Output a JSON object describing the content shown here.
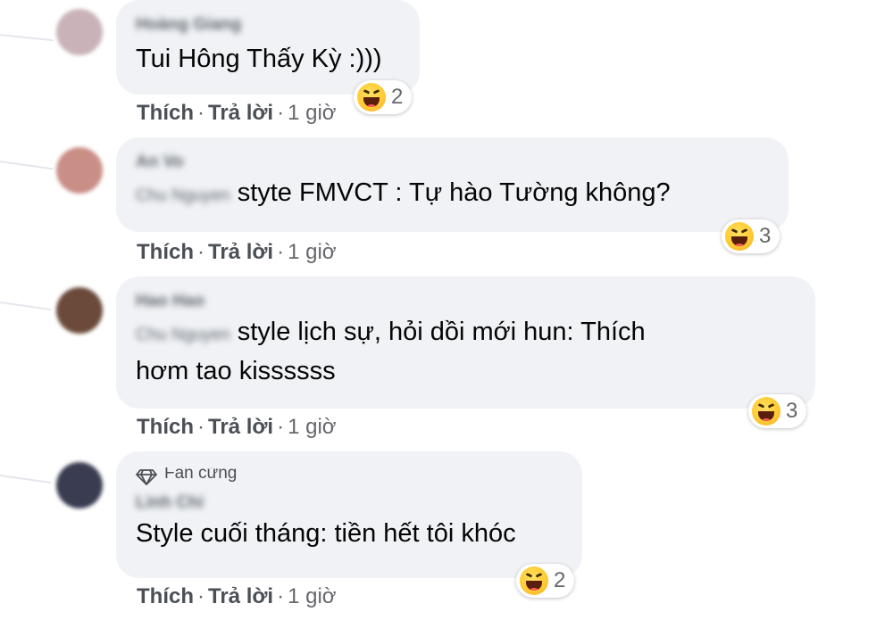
{
  "comments": [
    {
      "author_blurred": "Hoàng Giang",
      "tag_blurred": "",
      "text_line1": "Tui Hông Thấy Kỳ :)))",
      "text_line2": "",
      "reaction_count": "2",
      "actions": {
        "like": "Thích",
        "reply": "Trả lời",
        "sep": "·",
        "time": "1 giờ"
      },
      "avatar_color": "#c9b3b8"
    },
    {
      "author_blurred": "An Vo",
      "tag_blurred": "Chu Nguyen",
      "text_line1": "styte FMVCT : Tự hào Tường không?",
      "text_line2": "",
      "reaction_count": "3",
      "actions": {
        "like": "Thích",
        "reply": "Trả lời",
        "sep": "·",
        "time": "1 giờ"
      },
      "avatar_color": "#c98f86"
    },
    {
      "author_blurred": "Hao Hao",
      "tag_blurred": "Chu Nguyen",
      "text_line1": "style lịch sự, hỏi dồi mới hun: Thích",
      "text_line2": "hơm tao kissssss",
      "reaction_count": "3",
      "actions": {
        "like": "Thích",
        "reply": "Trả lời",
        "sep": "·",
        "time": "1 giờ"
      },
      "avatar_color": "#6b4a3a"
    },
    {
      "badge": "Fan cứng",
      "author_blurred": "Linh Chi",
      "tag_blurred": "",
      "text_line1": "Style cuối tháng: tiền hết tôi khóc",
      "text_line2": "",
      "reaction_count": "2",
      "actions": {
        "like": "Thích",
        "reply": "Trả lời",
        "sep": "·",
        "time": "1 giờ"
      },
      "avatar_color": "#3a3d52"
    }
  ],
  "colors": {
    "bubble": "#f0f2f5",
    "meta": "#65676b",
    "text": "#050505"
  },
  "icons": {
    "reaction": "haha-emoji-icon",
    "badge": "diamond-icon"
  }
}
